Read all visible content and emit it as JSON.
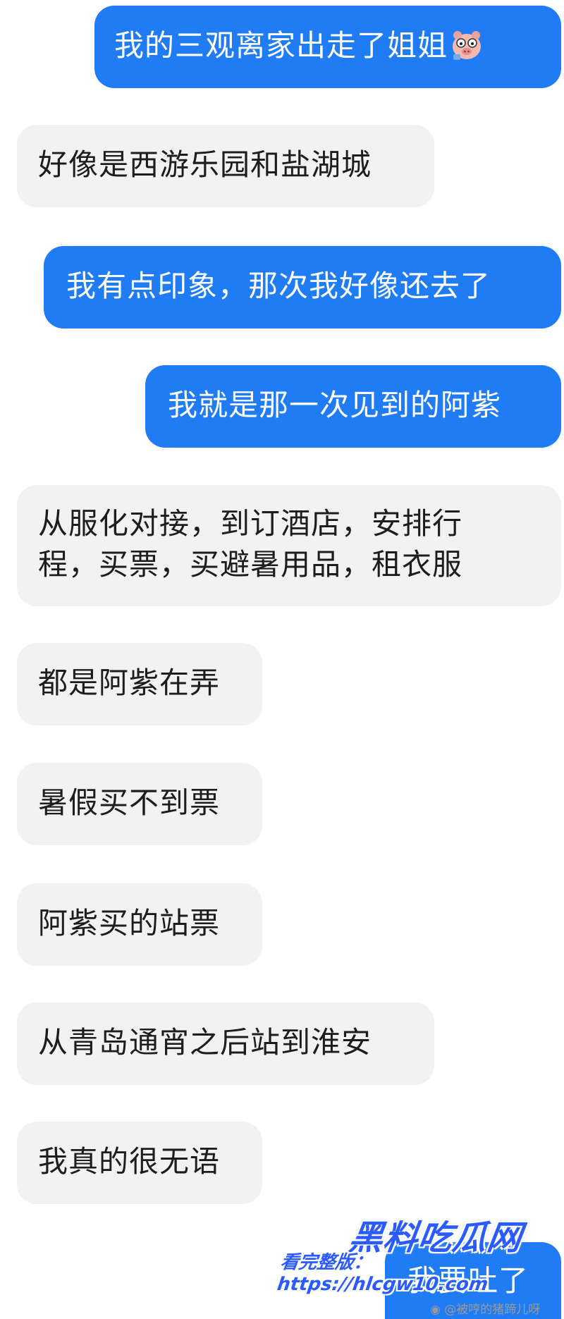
{
  "messages": [
    {
      "side": "out",
      "text": "我的三观离家出走了姐姐",
      "emoji": "pig-emoji-icon"
    },
    {
      "side": "in",
      "text": "好像是西游乐园和盐湖城"
    },
    {
      "side": "out",
      "text": "我有点印象，那次我好像还去了"
    },
    {
      "side": "out",
      "text": "我就是那一次见到的阿紫"
    },
    {
      "side": "in",
      "lines": [
        "从服化对接，到订酒店，安排行",
        "程，买票，买避暑用品，租衣服"
      ]
    },
    {
      "side": "in",
      "text": "都是阿紫在弄"
    },
    {
      "side": "in",
      "text": "暑假买不到票"
    },
    {
      "side": "in",
      "text": "阿紫买的站票"
    },
    {
      "side": "in",
      "text": "从青岛通宵之后站到淮安"
    },
    {
      "side": "in",
      "text": "我真的很无语"
    },
    {
      "side": "out",
      "text": "我要吐了"
    }
  ],
  "watermark": {
    "brand": "黑料吃瓜网",
    "url": "看完整版：https://hlcgw10.com",
    "weibo": "@被哼的猪蹄儿呀"
  },
  "colors": {
    "outgoing_bubble": "#1f7cf5",
    "incoming_bubble": "#f2f2f3",
    "watermark_blue": "#2a5bff"
  }
}
